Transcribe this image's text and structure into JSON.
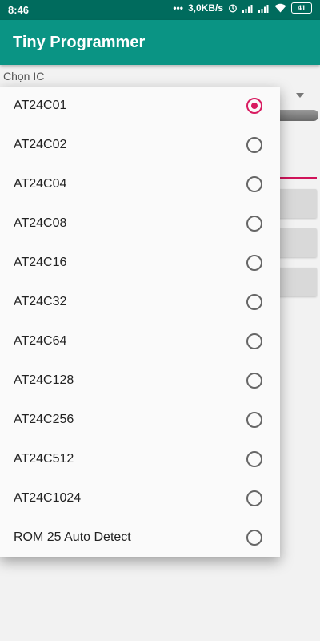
{
  "status_bar": {
    "time": "8:46",
    "dots": "•••",
    "speed": "3,0KB/s",
    "icons": [
      "alarm-icon",
      "signal-icon",
      "signal-icon",
      "wifi-icon"
    ],
    "battery": "41"
  },
  "app_bar": {
    "title": "Tiny Programmer"
  },
  "form": {
    "ic_label": "Chọn IC"
  },
  "dropdown": {
    "selected": "AT24C01",
    "options": [
      "AT24C01",
      "AT24C02",
      "AT24C04",
      "AT24C08",
      "AT24C16",
      "AT24C32",
      "AT24C64",
      "AT24C128",
      "AT24C256",
      "AT24C512",
      "AT24C1024",
      "ROM 25 Auto Detect"
    ]
  },
  "colors": {
    "status_bar": "#006b5d",
    "app_bar": "#0a9484",
    "accent": "#d81b60"
  }
}
